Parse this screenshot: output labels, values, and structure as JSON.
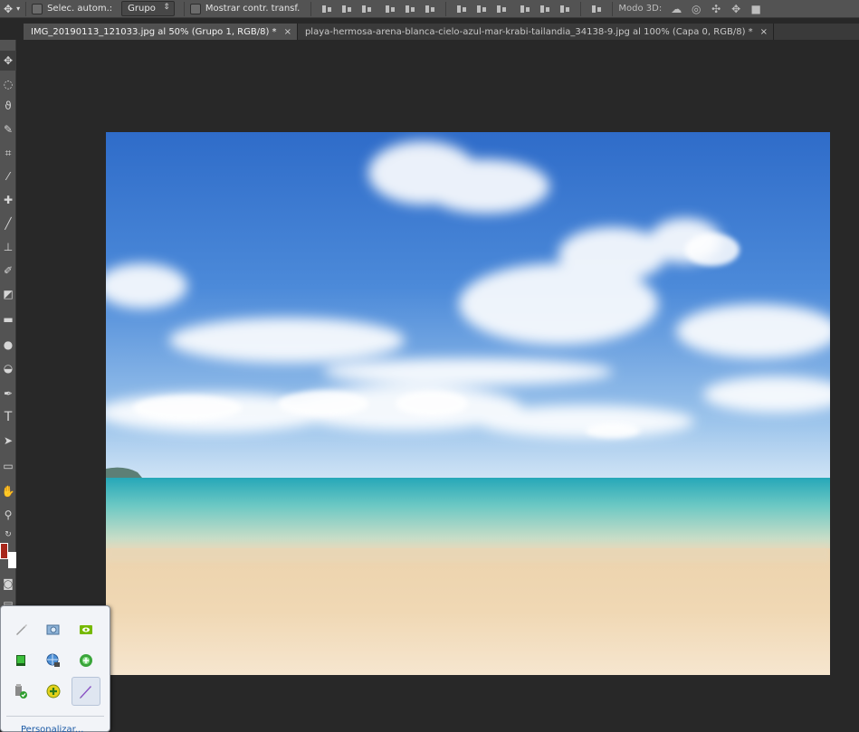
{
  "options_bar": {
    "auto_select_label": "Selec. autom.:",
    "auto_select_value": "Grupo",
    "show_transform_label": "Mostrar contr. transf.",
    "mode_3d_label": "Modo 3D:"
  },
  "tabs": [
    {
      "label": "IMG_20190113_121033.jpg al 50% (Grupo 1, RGB/8) *",
      "active": true
    },
    {
      "label": "playa-hermosa-arena-blanca-cielo-azul-mar-krabi-tailandia_34138-9.jpg al 100% (Capa 0, RGB/8) *",
      "active": false
    }
  ],
  "tab_close_glyph": "×",
  "colors": {
    "foreground": "#a8271b",
    "background": "#ffffff"
  },
  "tray": {
    "icons": [
      "pen-tablet-icon",
      "screen-capture-icon",
      "nvidia-icon",
      "memory-card-icon",
      "network-globe-icon",
      "green-orb-icon",
      "safe-remove-usb-icon",
      "add-plus-icon",
      "pen-stylus-icon"
    ],
    "customize_label": "Personalizar..."
  }
}
